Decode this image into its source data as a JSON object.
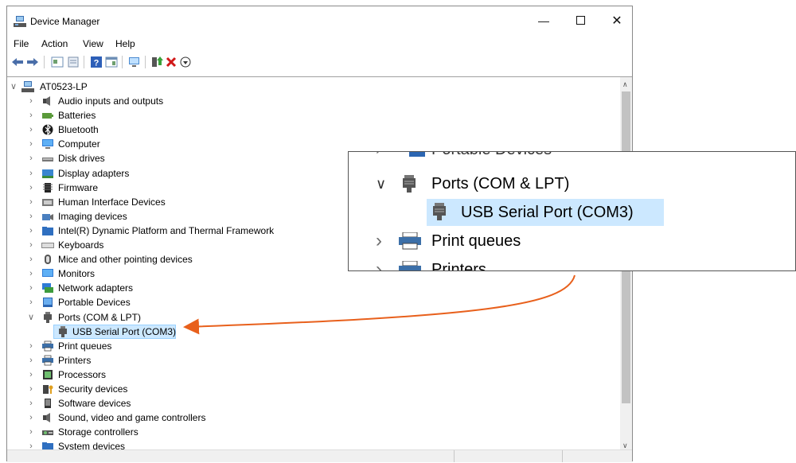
{
  "window": {
    "title": "Device Manager"
  },
  "menu": {
    "items": [
      "File",
      "Action",
      "View",
      "Help"
    ]
  },
  "toolbar": {
    "icons": [
      "back-icon",
      "forward-icon",
      "properties-icon",
      "update-driver-icon",
      "help-icon",
      "console-icon",
      "scan-hardware-icon",
      "enable-device-icon",
      "uninstall-icon",
      "download-icon"
    ]
  },
  "tree": {
    "root": "AT0523-LP",
    "items": [
      {
        "label": "Audio inputs and outputs",
        "icon": "speaker-icon"
      },
      {
        "label": "Batteries",
        "icon": "battery-icon"
      },
      {
        "label": "Bluetooth",
        "icon": "bluetooth-icon"
      },
      {
        "label": "Computer",
        "icon": "computer-icon"
      },
      {
        "label": "Disk drives",
        "icon": "disk-icon"
      },
      {
        "label": "Display adapters",
        "icon": "display-adapter-icon"
      },
      {
        "label": "Firmware",
        "icon": "firmware-icon"
      },
      {
        "label": "Human Interface Devices",
        "icon": "hid-icon"
      },
      {
        "label": "Imaging devices",
        "icon": "camera-icon"
      },
      {
        "label": "Intel(R) Dynamic Platform and Thermal Framework",
        "icon": "folder-icon"
      },
      {
        "label": "Keyboards",
        "icon": "keyboard-icon"
      },
      {
        "label": "Mice and other pointing devices",
        "icon": "mouse-icon"
      },
      {
        "label": "Monitors",
        "icon": "monitor-icon"
      },
      {
        "label": "Network adapters",
        "icon": "network-icon"
      },
      {
        "label": "Portable Devices",
        "icon": "portable-icon"
      },
      {
        "label": "Ports (COM & LPT)",
        "icon": "port-icon",
        "expanded": true
      },
      {
        "label": "USB Serial Port (COM3)",
        "icon": "port-icon",
        "child": true,
        "selected": true
      },
      {
        "label": "Print queues",
        "icon": "printer-icon"
      },
      {
        "label": "Printers",
        "icon": "printer-icon"
      },
      {
        "label": "Processors",
        "icon": "processor-icon"
      },
      {
        "label": "Security devices",
        "icon": "security-icon"
      },
      {
        "label": "Software devices",
        "icon": "software-icon"
      },
      {
        "label": "Sound, video and game controllers",
        "icon": "speaker-icon"
      },
      {
        "label": "Storage controllers",
        "icon": "storage-icon"
      },
      {
        "label": "System devices",
        "icon": "system-icon"
      }
    ]
  },
  "zoom": {
    "partial_top": "Portable Devices",
    "ports_label": "Ports (COM & LPT)",
    "port_child": "USB Serial Port (COM3)",
    "print_queues": "Print queues",
    "partial_bottom": "Printers"
  },
  "colors": {
    "accent_arrow": "#e8601c",
    "selection": "#cce8ff"
  }
}
